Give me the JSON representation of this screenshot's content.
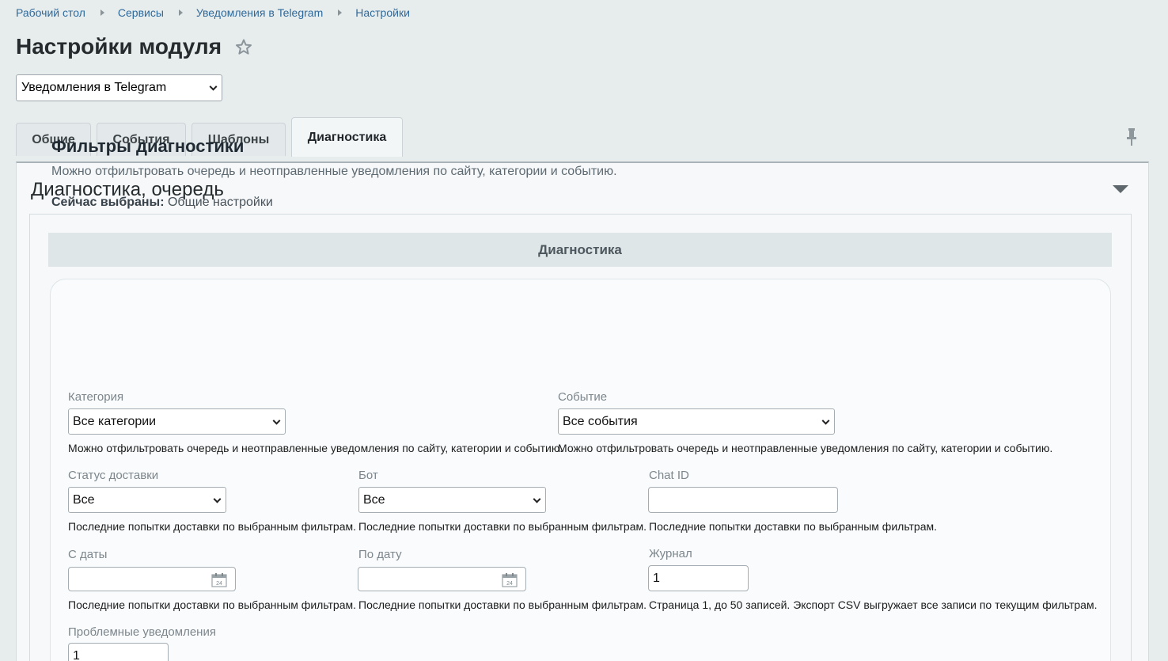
{
  "breadcrumb": [
    "Рабочий стол",
    "Сервисы",
    "Уведомления в Telegram",
    "Настройки"
  ],
  "page_title": "Настройки модуля",
  "module_select": "Уведомления в Telegram",
  "tabs": [
    "Общие",
    "События",
    "Шаблоны",
    "Диагностика"
  ],
  "active_tab": "Диагностика",
  "panel_title": "Диагностика, очередь",
  "section_header": "Диагностика",
  "card": {
    "title": "Фильтры диагностики",
    "description": "Можно отфильтровать очередь и неотправленные уведомления по сайту, категории и событию.",
    "current_label": "Сейчас выбраны:",
    "current_value": "Общие настройки"
  },
  "filters": {
    "category": {
      "label": "Категория",
      "value": "Все категории",
      "hint": "Можно отфильтровать очередь и неотправленные уведомления по сайту, категории и событию."
    },
    "event": {
      "label": "Событие",
      "value": "Все события",
      "hint": "Можно отфильтровать очередь и неотправленные уведомления по сайту, категории и событию."
    },
    "status": {
      "label": "Статус доставки",
      "value": "Все",
      "hint": "Последние попытки доставки по выбранным фильтрам."
    },
    "bot": {
      "label": "Бот",
      "value": "Все",
      "hint": "Последние попытки доставки по выбранным фильтрам."
    },
    "chat_id": {
      "label": "Chat ID",
      "value": "",
      "hint": "Последние попытки доставки по выбранным фильтрам."
    },
    "date_from": {
      "label": "С даты",
      "value": "",
      "hint": "Последние попытки доставки по выбранным фильтрам.",
      "icon_text": "24"
    },
    "date_to": {
      "label": "По дату",
      "value": "",
      "hint": "Последние попытки доставки по выбранным фильтрам.",
      "icon_text": "24"
    },
    "journal": {
      "label": "Журнал",
      "value": "1",
      "hint": "Страница 1, до 50 записей. Экспорт CSV выгружает все записи по текущим фильтрам."
    },
    "problem": {
      "label": "Проблемные уведомления",
      "value": "1"
    }
  }
}
